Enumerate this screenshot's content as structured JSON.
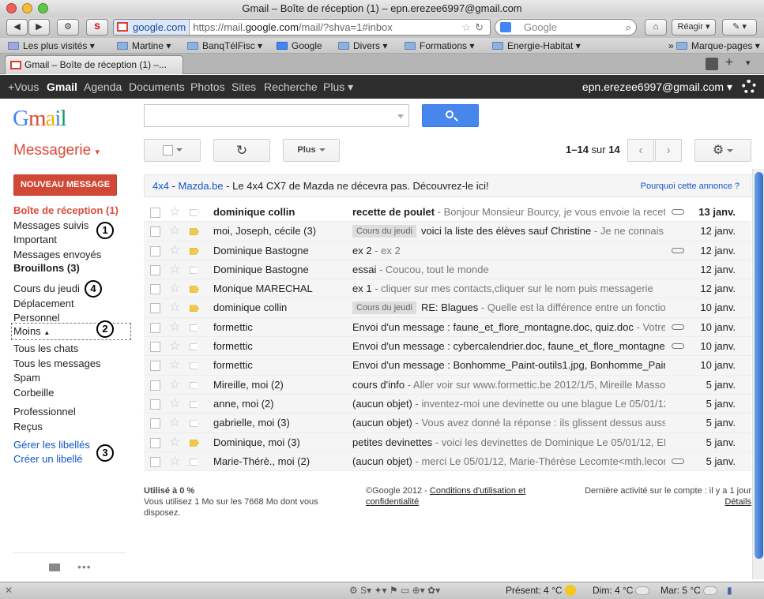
{
  "window": {
    "title": "Gmail – Boîte de réception (1) – epn.erezee6997@gmail.com"
  },
  "browser": {
    "site": "google.com",
    "url_pre": "https://mail.",
    "url_domain": "google.com",
    "url_post": "/mail/?shva=1#inbox",
    "search_placeholder": "Google",
    "react_label": "Réagir",
    "bookmarks": [
      "Les plus visités",
      "Martine",
      "BanqTélFisc",
      "Google",
      "Divers",
      "Formations",
      "Energie-Habitat",
      "Marque-pages"
    ],
    "tab_title": "Gmail – Boîte de réception (1) –..."
  },
  "google_bar": {
    "items": [
      "+Vous",
      "Gmail",
      "Agenda",
      "Documents",
      "Photos",
      "Sites",
      "Recherche",
      "Plus"
    ],
    "account": "epn.erezee6997@gmail.com"
  },
  "logo": {
    "text": "Gmail"
  },
  "toolbar": {
    "title": "Messagerie",
    "more": "Plus",
    "range": "1–14",
    "of": "sur",
    "total": "14"
  },
  "sidebar": {
    "compose": "NOUVEAU MESSAGE",
    "labels": [
      "Boîte de réception (1)",
      "Messages suivis",
      "Important",
      "Messages envoyés",
      "Brouillons (3)",
      "Cours du jeudi",
      "Déplacement",
      "Personnel",
      "Moins",
      "Tous les chats",
      "Tous les messages",
      "Spam",
      "Corbeille",
      "Professionnel",
      "Reçus",
      "Gérer les libellés",
      "Créer un libellé"
    ],
    "markers": [
      "1",
      "4",
      "2",
      "3"
    ]
  },
  "ad": {
    "lead": "4x4",
    "sep": " - ",
    "site": "Mazda.be",
    "text": " - Le 4x4 CX7 de Mazda ne décevra pas. Découvrez-le ici!",
    "why": "Pourquoi cette annonce ?"
  },
  "emails": [
    {
      "from": "dominique collin",
      "tag": "",
      "subject": "recette de poulet",
      "snippet": " - Bonjour Monsieur Bourcy, je vous envoie la recett",
      "date": "13 janv.",
      "unread": true,
      "important": false,
      "attach": true
    },
    {
      "from": "moi, Joseph, cécile (3)",
      "tag": "Cours du jeudi",
      "subject": "voici la liste des élèves sauf Christine",
      "snippet": " - Je ne connais",
      "date": "12 janv.",
      "unread": false,
      "important": true,
      "attach": false
    },
    {
      "from": "Dominique Bastogne",
      "tag": "",
      "subject": "ex 2",
      "snippet": " - ex 2",
      "date": "12 janv.",
      "unread": false,
      "important": true,
      "attach": true
    },
    {
      "from": "Dominique Bastogne",
      "tag": "",
      "subject": "essai",
      "snippet": " - Coucou, tout le monde",
      "date": "12 janv.",
      "unread": false,
      "important": false,
      "attach": false
    },
    {
      "from": "Monique MARECHAL",
      "tag": "",
      "subject": "ex 1",
      "snippet": " - cliquer sur mes contacts,cliquer sur le nom puis messagerie",
      "date": "12 janv.",
      "unread": false,
      "important": true,
      "attach": false
    },
    {
      "from": "dominique collin",
      "tag": "Cours du jeudi",
      "subject": "RE: Blagues",
      "snippet": " - Quelle est la différence entre un fonctio",
      "date": "10 janv.",
      "unread": false,
      "important": true,
      "attach": false
    },
    {
      "from": "formettic",
      "tag": "",
      "subject": "Envoi d'un message : faune_et_flore_montagne.doc, quiz.doc",
      "snippet": " - Votre",
      "date": "10 janv.",
      "unread": false,
      "important": false,
      "attach": true
    },
    {
      "from": "formettic",
      "tag": "",
      "subject": "Envoi d'un message : cybercalendrier.doc, faune_et_flore_montagne.",
      "snippet": "",
      "date": "10 janv.",
      "unread": false,
      "important": false,
      "attach": true
    },
    {
      "from": "formettic",
      "tag": "",
      "subject": "Envoi d'un message : Bonhomme_Paint-outils1.jpg, Bonhomme_Pain",
      "snippet": "",
      "date": "10 janv.",
      "unread": false,
      "important": false,
      "attach": false
    },
    {
      "from": "Mireille, moi (2)",
      "tag": "",
      "subject": "cours d'info",
      "snippet": " - Aller voir sur www.formettic.be 2012/1/5, Mireille Massoz",
      "date": "5 janv.",
      "unread": false,
      "important": false,
      "attach": false
    },
    {
      "from": "anne, moi (2)",
      "tag": "",
      "subject": "(aucun objet)",
      "snippet": " - inventez-moi une devinette ou une blague Le 05/01/12",
      "date": "5 janv.",
      "unread": false,
      "important": false,
      "attach": false
    },
    {
      "from": "gabrielle, moi (3)",
      "tag": "",
      "subject": "(aucun objet)",
      "snippet": " - Vous avez donné la réponse : ils glissent dessus aussi",
      "date": "5 janv.",
      "unread": false,
      "important": false,
      "attach": false
    },
    {
      "from": "Dominique, moi (3)",
      "tag": "",
      "subject": "petites devinettes",
      "snippet": " - voici les devinettes de Dominique Le 05/01/12, EP",
      "date": "5 janv.",
      "unread": false,
      "important": true,
      "attach": false
    },
    {
      "from": "Marie-Thérè., moi (2)",
      "tag": "",
      "subject": "(aucun objet)",
      "snippet": " - merci Le 05/01/12, Marie-Thérèse Lecomte<mth.lecom",
      "date": "5 janv.",
      "unread": false,
      "important": false,
      "attach": true
    }
  ],
  "footer": {
    "usage_title": "Utilisé à 0 %",
    "usage_text": "Vous utilisez 1 Mo sur les 7668 Mo dont vous disposez.",
    "copyright": "©Google 2012 - ",
    "terms": "Conditions d'utilisation et confidentialité",
    "activity": "Dernière activité sur le compte : il y a 1 jour",
    "details": "Détails"
  },
  "statusbar": {
    "present": "Présent: 4 °C",
    "tue": "Dim: 4 °C",
    "wed": "Mar: 5 °C"
  },
  "colors": {
    "accent": "#dd4b39",
    "link": "#1155cc",
    "search_btn": "#4787ed",
    "compose": "#d14836"
  }
}
